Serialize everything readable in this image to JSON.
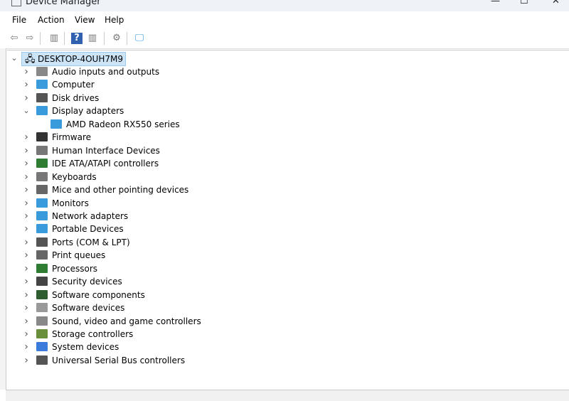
{
  "window": {
    "title": "Device Manager",
    "controls": [
      "—",
      "☐",
      "✕"
    ]
  },
  "menu": [
    "File",
    "Action",
    "View",
    "Help"
  ],
  "toolbar": [
    {
      "icon": "back-icon",
      "glyph": "⇦"
    },
    {
      "icon": "forward-icon",
      "glyph": "⇨"
    },
    {
      "icon": "show-hide-console-tree-icon",
      "glyph": "▥"
    },
    {
      "icon": "help-icon",
      "glyph": "?"
    },
    {
      "icon": "show-action-pane-icon",
      "glyph": "▥"
    },
    {
      "icon": "update-driver-icon",
      "glyph": "⚙"
    },
    {
      "icon": "monitor-icon",
      "glyph": "🖵"
    }
  ],
  "tree": {
    "root": "DESKTOP-4OUH7M9",
    "items": [
      {
        "label": "Audio inputs and outputs",
        "icon": "speaker-icon",
        "color": "#888888",
        "expanded": false
      },
      {
        "label": "Computer",
        "icon": "computer-icon",
        "color": "#3a9bdc",
        "expanded": false
      },
      {
        "label": "Disk drives",
        "icon": "disk-icon",
        "color": "#555555",
        "expanded": false
      },
      {
        "label": "Display adapters",
        "icon": "display-adapter-icon",
        "color": "#3a9bdc",
        "expanded": true,
        "children": [
          {
            "label": "AMD Radeon RX550 series",
            "icon": "display-adapter-icon",
            "color": "#3a9bdc"
          }
        ]
      },
      {
        "label": "Firmware",
        "icon": "firmware-icon",
        "color": "#333333",
        "expanded": false
      },
      {
        "label": "Human Interface Devices",
        "icon": "hid-icon",
        "color": "#777777",
        "expanded": false
      },
      {
        "label": "IDE ATA/ATAPI controllers",
        "icon": "ide-icon",
        "color": "#2e7d32",
        "expanded": false
      },
      {
        "label": "Keyboards",
        "icon": "keyboard-icon",
        "color": "#777777",
        "expanded": false
      },
      {
        "label": "Mice and other pointing devices",
        "icon": "mouse-icon",
        "color": "#666666",
        "expanded": false
      },
      {
        "label": "Monitors",
        "icon": "monitor-icon",
        "color": "#3a9bdc",
        "expanded": false
      },
      {
        "label": "Network adapters",
        "icon": "network-icon",
        "color": "#3a9bdc",
        "expanded": false
      },
      {
        "label": "Portable Devices",
        "icon": "portable-device-icon",
        "color": "#3a9bdc",
        "expanded": false
      },
      {
        "label": "Ports (COM & LPT)",
        "icon": "port-icon",
        "color": "#555555",
        "expanded": false
      },
      {
        "label": "Print queues",
        "icon": "printer-icon",
        "color": "#666666",
        "expanded": false
      },
      {
        "label": "Processors",
        "icon": "processor-icon",
        "color": "#2e7d32",
        "expanded": false
      },
      {
        "label": "Security devices",
        "icon": "security-icon",
        "color": "#444444",
        "expanded": false
      },
      {
        "label": "Software components",
        "icon": "software-component-icon",
        "color": "#2e5d32",
        "expanded": false
      },
      {
        "label": "Software devices",
        "icon": "software-device-icon",
        "color": "#999999",
        "expanded": false
      },
      {
        "label": "Sound, video and game controllers",
        "icon": "sound-icon",
        "color": "#888888",
        "expanded": false
      },
      {
        "label": "Storage controllers",
        "icon": "storage-icon",
        "color": "#6a8f3a",
        "expanded": false
      },
      {
        "label": "System devices",
        "icon": "system-icon",
        "color": "#3a7bdc",
        "expanded": false
      },
      {
        "label": "Universal Serial Bus controllers",
        "icon": "usb-icon",
        "color": "#555555",
        "expanded": false
      }
    ]
  }
}
